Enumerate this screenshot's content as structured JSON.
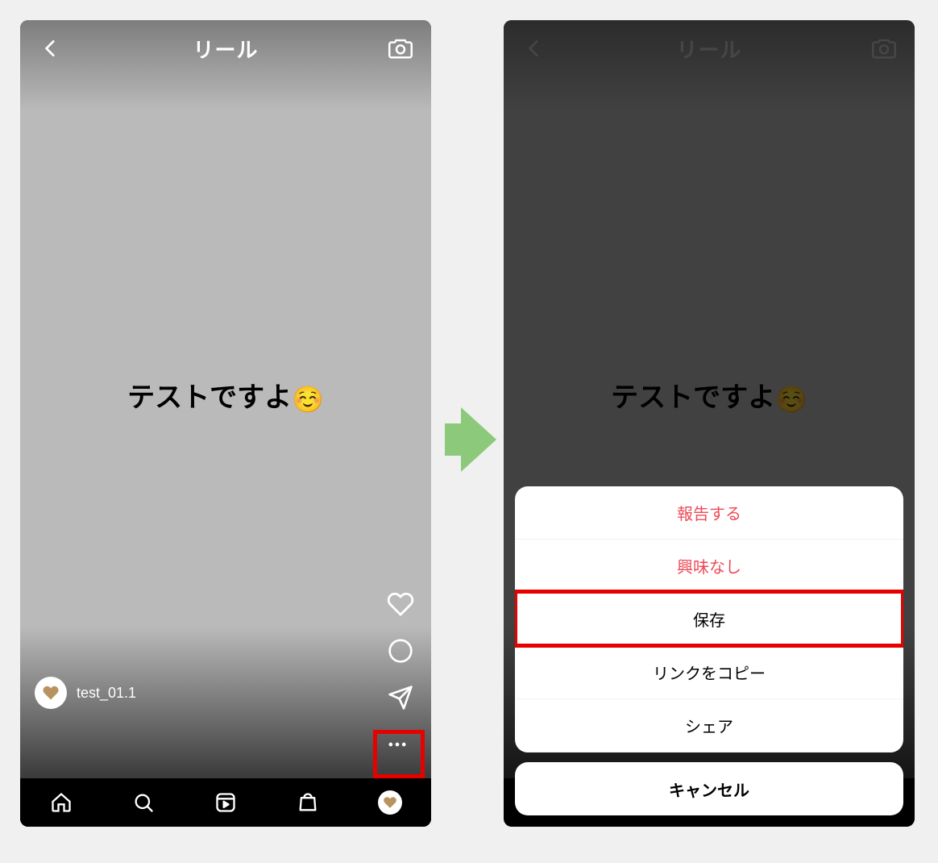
{
  "header": {
    "title": "リール",
    "back_icon": "back-chevron-icon",
    "camera_icon": "camera-icon"
  },
  "caption": {
    "text": "テストですよ",
    "emoji": "☺️"
  },
  "user": {
    "username": "test_01.1"
  },
  "right_actions": {
    "like_icon": "heart-icon",
    "comment_icon": "comment-icon",
    "share_icon": "send-icon"
  },
  "more_icon": "more-icon",
  "tab_bar": {
    "items": [
      "home-icon",
      "search-icon",
      "reels-icon",
      "shop-icon",
      "profile-avatar"
    ]
  },
  "action_sheet": {
    "items": [
      {
        "label": "報告する",
        "destructive": true
      },
      {
        "label": "興味なし",
        "destructive": true
      },
      {
        "label": "保存",
        "destructive": false,
        "highlighted": true
      },
      {
        "label": "リンクをコピー",
        "destructive": false
      },
      {
        "label": "シェア",
        "destructive": false
      }
    ],
    "cancel": "キャンセル"
  }
}
